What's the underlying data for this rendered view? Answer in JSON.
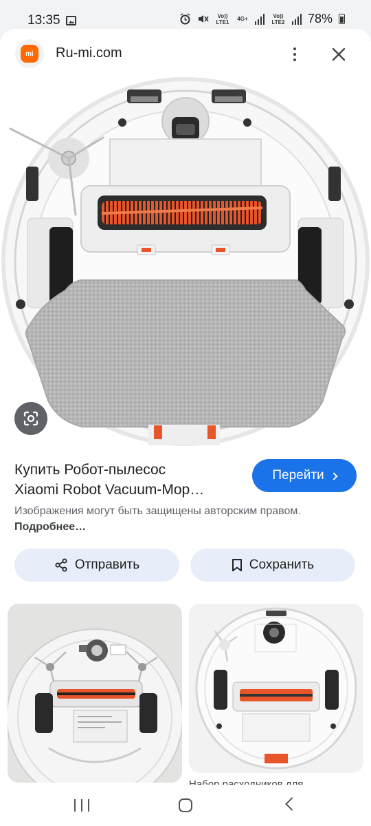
{
  "status_bar": {
    "time": "13:35",
    "battery": "78%",
    "sim1_label": "Vo)) LTE1",
    "sim2_label": "Vo)) LTE2",
    "network_label": "4G+",
    "icons": [
      "gallery-icon",
      "alarm-icon",
      "mute-icon",
      "signal-icon",
      "battery-icon"
    ]
  },
  "header": {
    "logo_text": "mi",
    "site_name": "Ru-mi.com"
  },
  "result": {
    "title_line1": "Купить Робот-пылесос",
    "title_line2": "Xiaomi Robot Vacuum-Mop…",
    "visit_label": "Перейти",
    "copyright_text": "Изображения могут быть защищены авторским правом.",
    "more_link": "Подробнее…"
  },
  "actions": {
    "share_label": "Отправить",
    "save_label": "Сохранить"
  },
  "related": {
    "caption": "Набор расходников для"
  },
  "colors": {
    "accent": "#1a73e8",
    "chip_bg": "#e8eef9",
    "brand": "#ff6900",
    "brush_orange": "#e8552a"
  }
}
